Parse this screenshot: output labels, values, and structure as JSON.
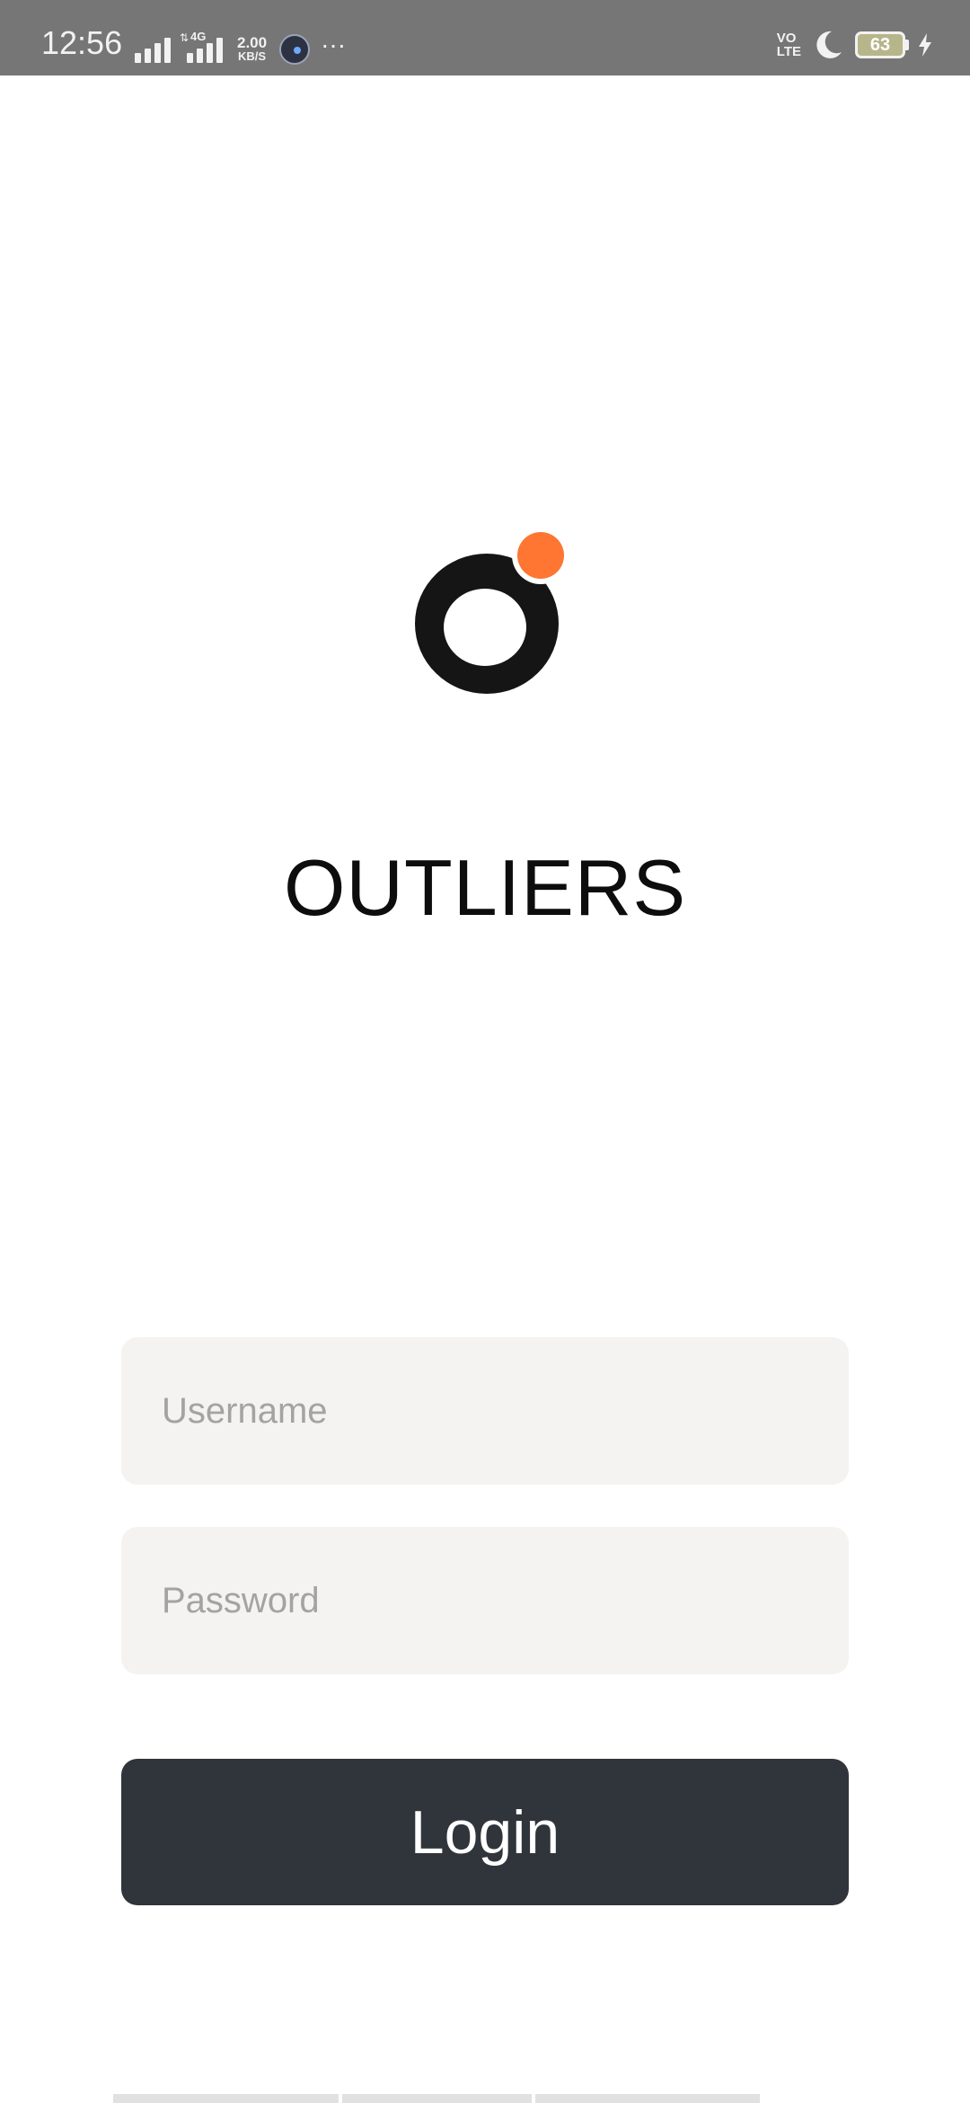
{
  "status_bar": {
    "time": "12:56",
    "network_type": "4G",
    "speed_value": "2.00",
    "speed_unit": "KB/S",
    "more": "···",
    "volte_top": "VO",
    "volte_bottom": "LTE",
    "battery_level": "63",
    "icons": [
      "signal-icon",
      "signal-4g-icon",
      "app-notification-icon",
      "more-icon",
      "volte-icon",
      "do-not-disturb-moon-icon",
      "battery-icon",
      "charging-bolt-icon"
    ]
  },
  "app": {
    "title": "OUTLIERS",
    "logo_icon": "outliers-logo-icon",
    "brand_colors": {
      "ring": "#151515",
      "dot": "#fe7631"
    }
  },
  "form": {
    "username_placeholder": "Username",
    "username_value": "",
    "password_placeholder": "Password",
    "password_value": "",
    "login_label": "Login"
  },
  "colors": {
    "button_bg": "#30343b",
    "field_bg": "#f4f3f1",
    "status_bar_bg": "#767676"
  }
}
